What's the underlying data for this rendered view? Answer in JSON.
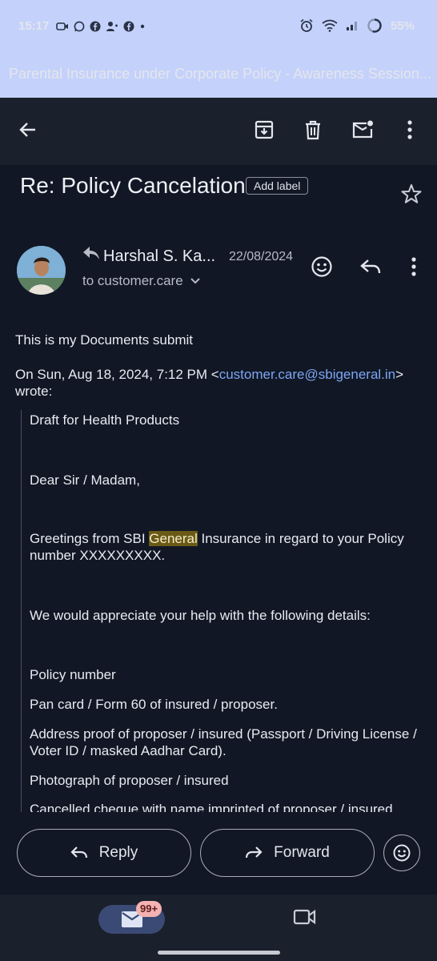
{
  "status": {
    "time": "15:17",
    "battery": "55%"
  },
  "notification": {
    "text": "Parental Insurance under Corporate Policy - Awareness Session..."
  },
  "email": {
    "subject": "Re: Policy Cancelation",
    "add_label": "Add label",
    "sender": "Harshal S. Ka...",
    "date": "22/08/2024",
    "to": "to customer.care",
    "body_intro": "This is my Documents  submit",
    "quote_header_prefix": "On Sun, Aug 18, 2024, 7:12 PM <",
    "quote_header_email": "customer.care@sbigeneral.in",
    "quote_header_suffix": ">",
    "quote_header_wrote": "wrote:",
    "quoted": {
      "line1": "Draft for Health Products",
      "line2": "Dear Sir / Madam,",
      "greeting_a": "Greetings from SBI ",
      "greeting_highlight": "General",
      "greeting_b": " Insurance in regard to your Policy number XXXXXXXXX.",
      "line4": "We would appreciate your help with the following details:",
      "line5": "Policy number",
      "line6": "Pan card / Form 60 of insured / proposer.",
      "line7": "Address proof of proposer / insured (Passport / Driving License / Voter ID / masked Aadhar Card).",
      "line8": "Photograph of proposer / insured",
      "line9": "Cancelled cheque with name imprinted of proposer / insured"
    }
  },
  "actions": {
    "reply": "Reply",
    "forward": "Forward"
  },
  "nav": {
    "mail_badge": "99+"
  },
  "colors": {
    "background": "#111725",
    "accent_link": "#7da6f3",
    "highlight": "#6a5a16",
    "notification": "#c4d1fb"
  }
}
